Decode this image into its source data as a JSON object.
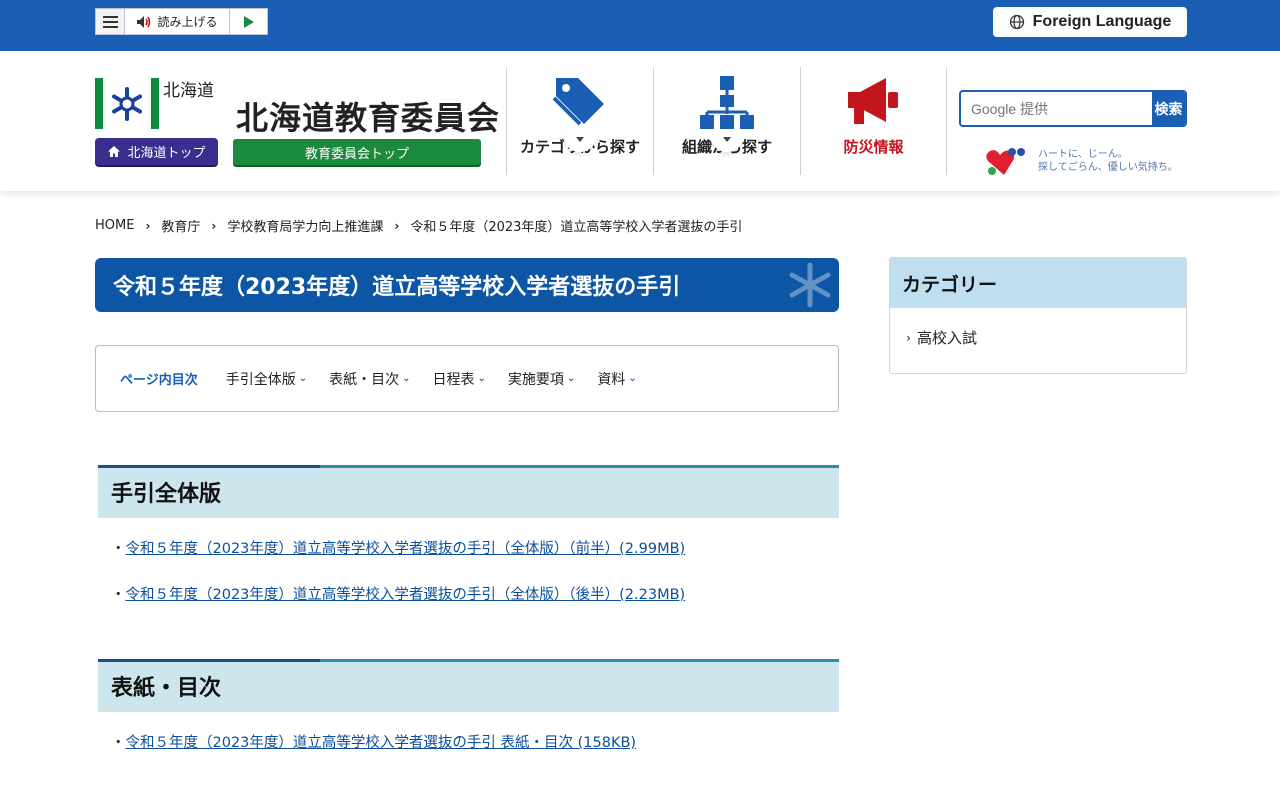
{
  "topbar": {
    "read_aloud_label": "読み上げる",
    "foreign_language_label": "Foreign Language"
  },
  "header": {
    "hokkaido_label": "北海道",
    "hokkaido_top_label": "北海道トップ",
    "board_title": "北海道教育委員会",
    "board_top_label": "教育委員会トップ",
    "nav": [
      {
        "label": "カテゴリから探す",
        "icon": "tag-icon"
      },
      {
        "label": "組織から探す",
        "icon": "org-chart-icon"
      },
      {
        "label": "防災情報",
        "icon": "megaphone-icon"
      }
    ],
    "search_placeholder": "Google 提供",
    "search_button": "検索",
    "banner_line1": "ハートに、じーん。",
    "banner_line2": "探してごらん、優しい気持ち。"
  },
  "breadcrumb": [
    "HOME",
    "教育庁",
    "学校教育局学力向上推進課",
    "令和５年度（2023年度）道立高等学校入学者選抜の手引"
  ],
  "page": {
    "title": "令和５年度（2023年度）道立高等学校入学者選抜の手引"
  },
  "toc": {
    "heading": "ページ内目次",
    "items": [
      "手引全体版",
      "表紙・目次",
      "日程表",
      "実施要項",
      "資料"
    ]
  },
  "sections": [
    {
      "heading": "手引全体版",
      "links": [
        "令和５年度（2023年度）道立高等学校入学者選抜の手引（全体版）（前半）(2.99MB)",
        "令和５年度（2023年度）道立高等学校入学者選抜の手引（全体版）（後半）(2.23MB)"
      ]
    },
    {
      "heading": "表紙・目次",
      "links": [
        "令和５年度（2023年度）道立高等学校入学者選抜の手引  表紙・目次 (158KB)"
      ]
    }
  ],
  "sidebar": {
    "category_heading": "カテゴリー",
    "items": [
      "高校入試"
    ]
  },
  "colors": {
    "brand_blue": "#1a5fb4",
    "title_blue": "#0d56a6",
    "green": "#1b8a3c",
    "purple": "#3a2f8f",
    "disaster_red": "#c4161c",
    "section_bg": "#cde6ee"
  }
}
